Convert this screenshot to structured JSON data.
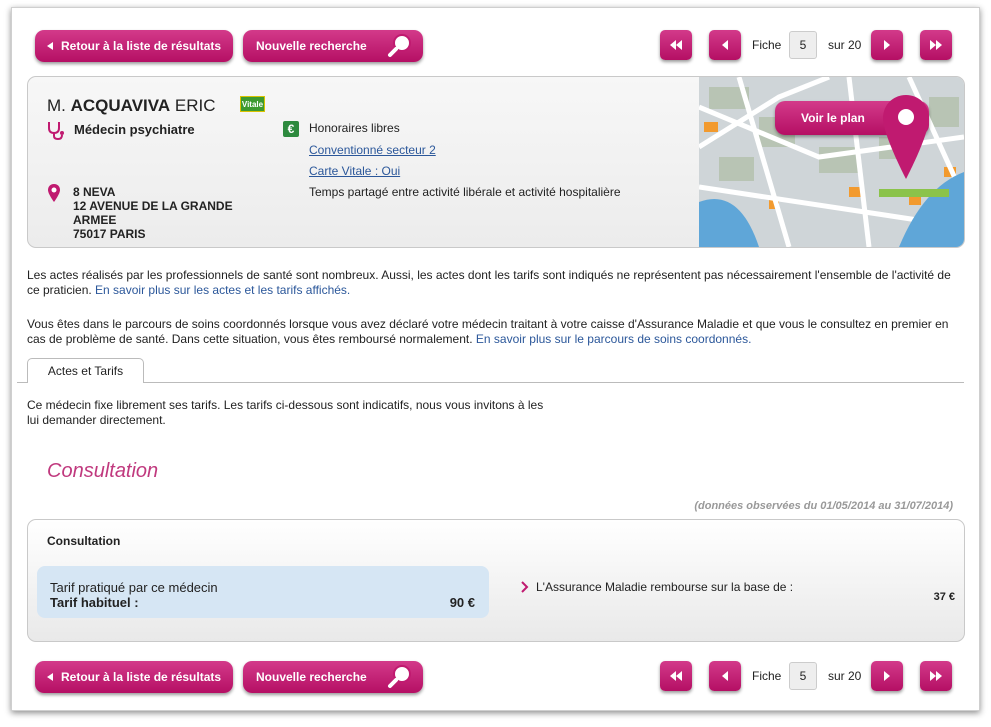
{
  "nav": {
    "back_label": "Retour à la liste de résultats",
    "new_search_label": "Nouvelle recherche",
    "fiche_label": "Fiche",
    "page_current": "5",
    "sur_label": "sur 20"
  },
  "doctor": {
    "title": "M.",
    "lastname": "ACQUAVIVA",
    "firstname": "ERIC",
    "vitale_badge": "Vitale",
    "specialty": "Médecin psychiatre",
    "address": [
      "8 NEVA",
      "12 AVENUE DE LA GRANDE",
      "ARMEE",
      "75017 PARIS"
    ],
    "euro_icon": "€",
    "fees_label": "Honoraires libres",
    "sector_link": "Conventionné secteur 2",
    "vitale_link": "Carte Vitale : Oui",
    "activity": "Temps partagé entre activité libérale et activité hospitalière",
    "map_button": "Voir le plan"
  },
  "info": {
    "para1": "Les actes réalisés par les professionnels de santé sont nombreux. Aussi, les actes dont les tarifs sont indiqués ne représentent pas nécessairement l'ensemble de l'activité de ce praticien.",
    "para1_link": "En savoir plus sur les actes et les tarifs affichés.",
    "para2": "Vous êtes dans le parcours de soins coordonnés lorsque vous avez déclaré votre médecin traitant à votre caisse d'Assurance Maladie et que vous le consultez en premier en cas de problème de santé. Dans cette situation, vous êtes remboursé normalement.",
    "para2_link": "En savoir plus sur le parcours de soins coordonnés."
  },
  "tabs": [
    {
      "label": "Actes et Tarifs",
      "active": true
    }
  ],
  "notice": "Ce médecin fixe librement ses tarifs. Les tarifs ci-dessous sont indicatifs, nous vous invitons à les lui demander directement.",
  "consultation": {
    "section_title": "Consultation",
    "observed": "(données observées du 01/05/2014 au 31/07/2014)",
    "box_title": "Consultation",
    "tarif_line1": "Tarif pratiqué par ce médecin",
    "tarif_line2": "Tarif habituel :",
    "tarif_value": "90 €",
    "reimburse_label": "L'Assurance Maladie rembourse sur la base de :",
    "reimburse_value": "37 €"
  },
  "colors": {
    "accent": "#b50f64",
    "link": "#2b579a",
    "title": "#c0397e"
  }
}
